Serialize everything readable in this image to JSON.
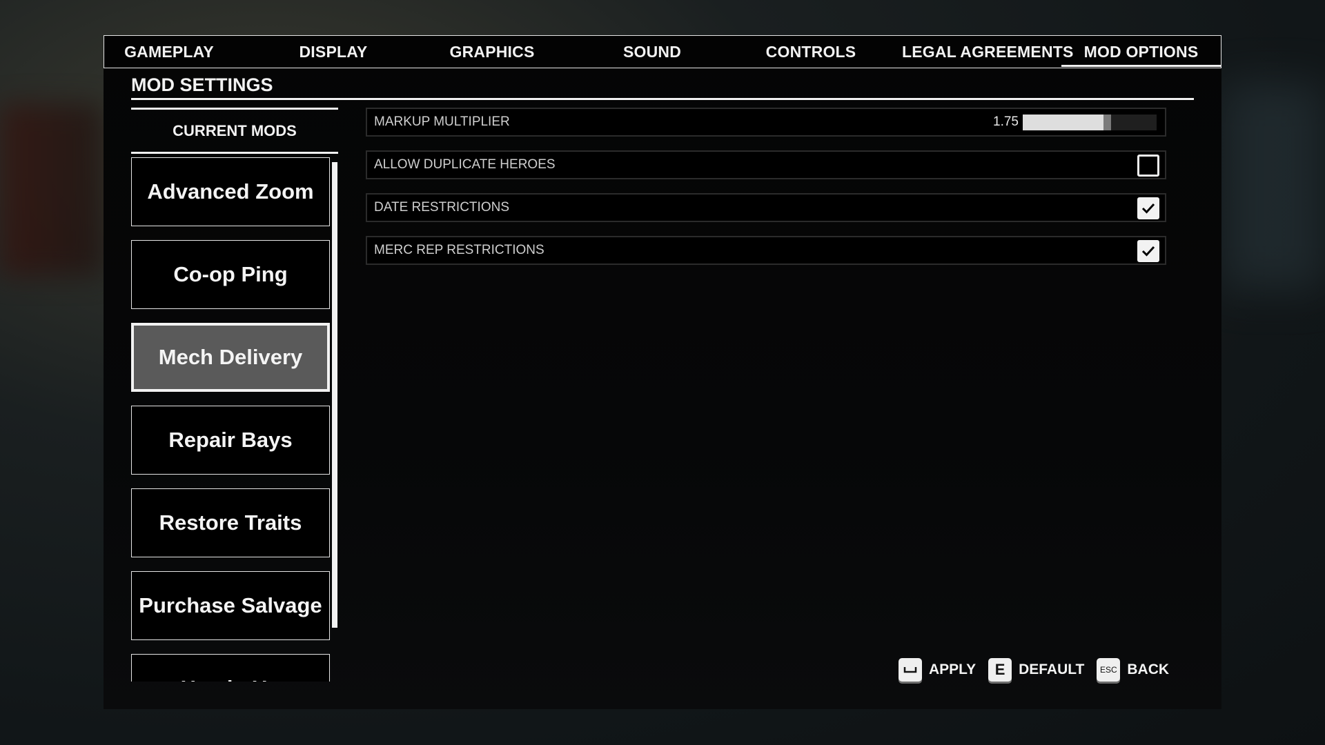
{
  "tabs": [
    {
      "label": "GAMEPLAY",
      "active": false
    },
    {
      "label": "DISPLAY",
      "active": false
    },
    {
      "label": "GRAPHICS",
      "active": false
    },
    {
      "label": "SOUND",
      "active": false
    },
    {
      "label": "CONTROLS",
      "active": false
    },
    {
      "label": "LEGAL AGREEMENTS",
      "active": false
    },
    {
      "label": "MOD OPTIONS",
      "active": true
    }
  ],
  "section_title": "MOD SETTINGS",
  "mods_header": "CURRENT MODS",
  "mods": [
    {
      "label": "Advanced Zoom",
      "selected": false
    },
    {
      "label": "Co-op Ping",
      "selected": false
    },
    {
      "label": "Mech Delivery",
      "selected": true
    },
    {
      "label": "Repair Bays",
      "selected": false
    },
    {
      "label": "Restore Traits",
      "selected": false
    },
    {
      "label": "Purchase Salvage",
      "selected": false
    },
    {
      "label": "Heads-Up",
      "selected": false
    }
  ],
  "settings": [
    {
      "label": "MARKUP MULTIPLIER",
      "type": "slider",
      "value_text": "1.75",
      "fill_fraction": 0.66
    },
    {
      "label": "ALLOW DUPLICATE HEROES",
      "type": "checkbox",
      "checked": false
    },
    {
      "label": "DATE RESTRICTIONS",
      "type": "checkbox",
      "checked": true
    },
    {
      "label": "MERC REP RESTRICTIONS",
      "type": "checkbox",
      "checked": true
    }
  ],
  "footer": {
    "apply": {
      "key": "space-key-icon",
      "label": "APPLY"
    },
    "default": {
      "key": "E",
      "label": "DEFAULT"
    },
    "back": {
      "key": "ESC",
      "label": "BACK"
    }
  }
}
